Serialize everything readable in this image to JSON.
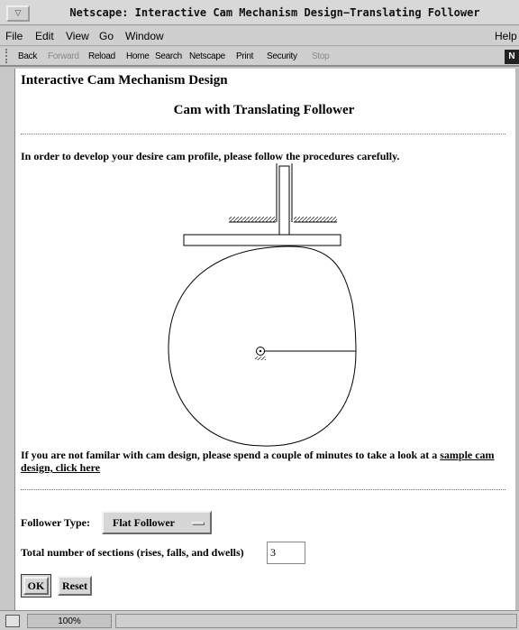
{
  "window": {
    "title": "Netscape: Interactive Cam Mechanism Design−Translating Follower",
    "control_glyph": "▽"
  },
  "menu": {
    "items": [
      "File",
      "Edit",
      "View",
      "Go",
      "Window"
    ],
    "help": "Help"
  },
  "toolbar": {
    "back": "Back",
    "forward": "Forward",
    "reload": "Reload",
    "home": "Home",
    "search": "Search",
    "netscape": "Netscape",
    "print": "Print",
    "security": "Security",
    "stop": "Stop",
    "logo_letter": "N"
  },
  "page": {
    "heading": "Interactive Cam Mechanism Design",
    "subheading": "Cam with Translating Follower",
    "instructions": "In order to develop your desire cam profile, please follow the procedures carefully.",
    "help_text": "If you are not familar with cam design, please spend a couple of minutes to take a look at a ",
    "help_link": "sample cam design, click here",
    "follower_label": "Follower Type:",
    "follower_value": "Flat Follower",
    "sections_label": "Total number of sections (rises, falls, and dwells)",
    "sections_value": "3",
    "ok_label": "OK",
    "reset_label": "Reset"
  },
  "status": {
    "zoom": "100%"
  },
  "colors": {
    "window_chrome": "#cfcfcf",
    "content_bg": "#ffffff",
    "text": "#000000",
    "disabled_text": "#8a8a8a"
  }
}
